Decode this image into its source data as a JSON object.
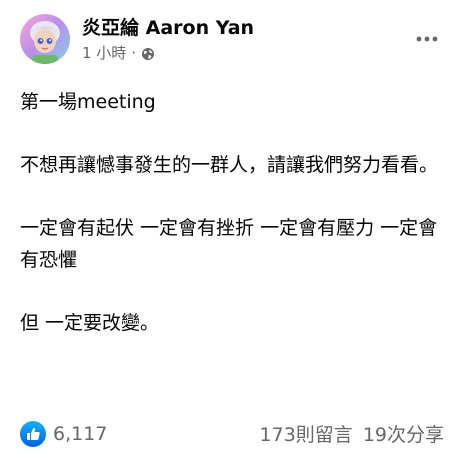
{
  "post": {
    "author": "炎亞綸 Aaron Yan",
    "time": "1 小時",
    "dot": "·",
    "privacy_icon": "globe-icon",
    "more_icon": "more-horizontal-icon",
    "paragraphs": [
      "第一場meeting",
      "不想再讓憾事發生的一群人，請讓我們努力看看。",
      "一定會有起伏 一定會有挫折 一定會有壓力 一定會有恐懼",
      "但 一定要改變。"
    ]
  },
  "footer": {
    "reaction_icon": "like-icon",
    "reaction_count": "6,117",
    "comments": "173則留言",
    "shares": "19次分享"
  },
  "colors": {
    "text": "#050505",
    "secondary": "#65676b",
    "like_blue": "#1877f2"
  }
}
